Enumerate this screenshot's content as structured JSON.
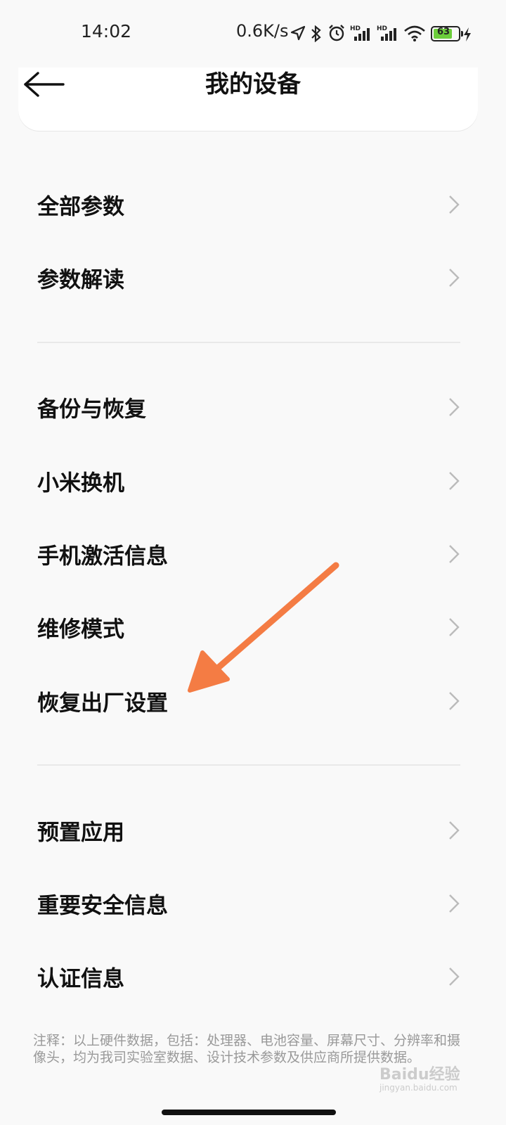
{
  "status_bar": {
    "time": "14:02",
    "speed": "0.6K/s",
    "battery": "63",
    "icons": [
      "location-icon",
      "bluetooth-icon",
      "alarm-icon",
      "signal-hd-icon",
      "signal-hd-icon",
      "wifi-icon",
      "battery-icon",
      "charging-icon"
    ]
  },
  "header": {
    "title": "我的设备",
    "back_icon": "back-arrow-icon"
  },
  "groups": [
    {
      "items": [
        {
          "label": "全部参数"
        },
        {
          "label": "参数解读"
        }
      ]
    },
    {
      "items": [
        {
          "label": "备份与恢复"
        },
        {
          "label": "小米换机"
        },
        {
          "label": "手机激活信息"
        },
        {
          "label": "维修模式"
        },
        {
          "label": "恢复出厂设置"
        }
      ]
    },
    {
      "items": [
        {
          "label": "预置应用"
        },
        {
          "label": "重要安全信息"
        },
        {
          "label": "认证信息"
        }
      ]
    }
  ],
  "note": "注释：以上硬件数据，包括：处理器、电池容量、屏幕尺寸、分辨率和摄像头，均为我司实验室数据、设计技术参数及供应商所提供数据。",
  "watermark": {
    "brand": "Baidu经验",
    "url": "jingyan.baidu.com"
  },
  "colors": {
    "arrow": "#f47c44",
    "background": "#f9f9f9"
  }
}
